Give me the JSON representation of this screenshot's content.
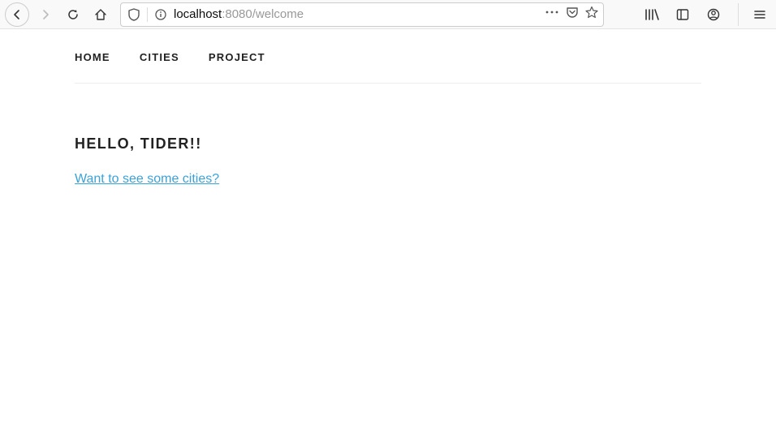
{
  "url": {
    "host": "localhost",
    "rest": ":8080/welcome"
  },
  "site_nav": {
    "items": [
      {
        "label": "HOME"
      },
      {
        "label": "CITIES"
      },
      {
        "label": "PROJECT"
      }
    ]
  },
  "main": {
    "heading": "HELLO, TIDER!!",
    "cities_link": "Want to see some cities?"
  }
}
